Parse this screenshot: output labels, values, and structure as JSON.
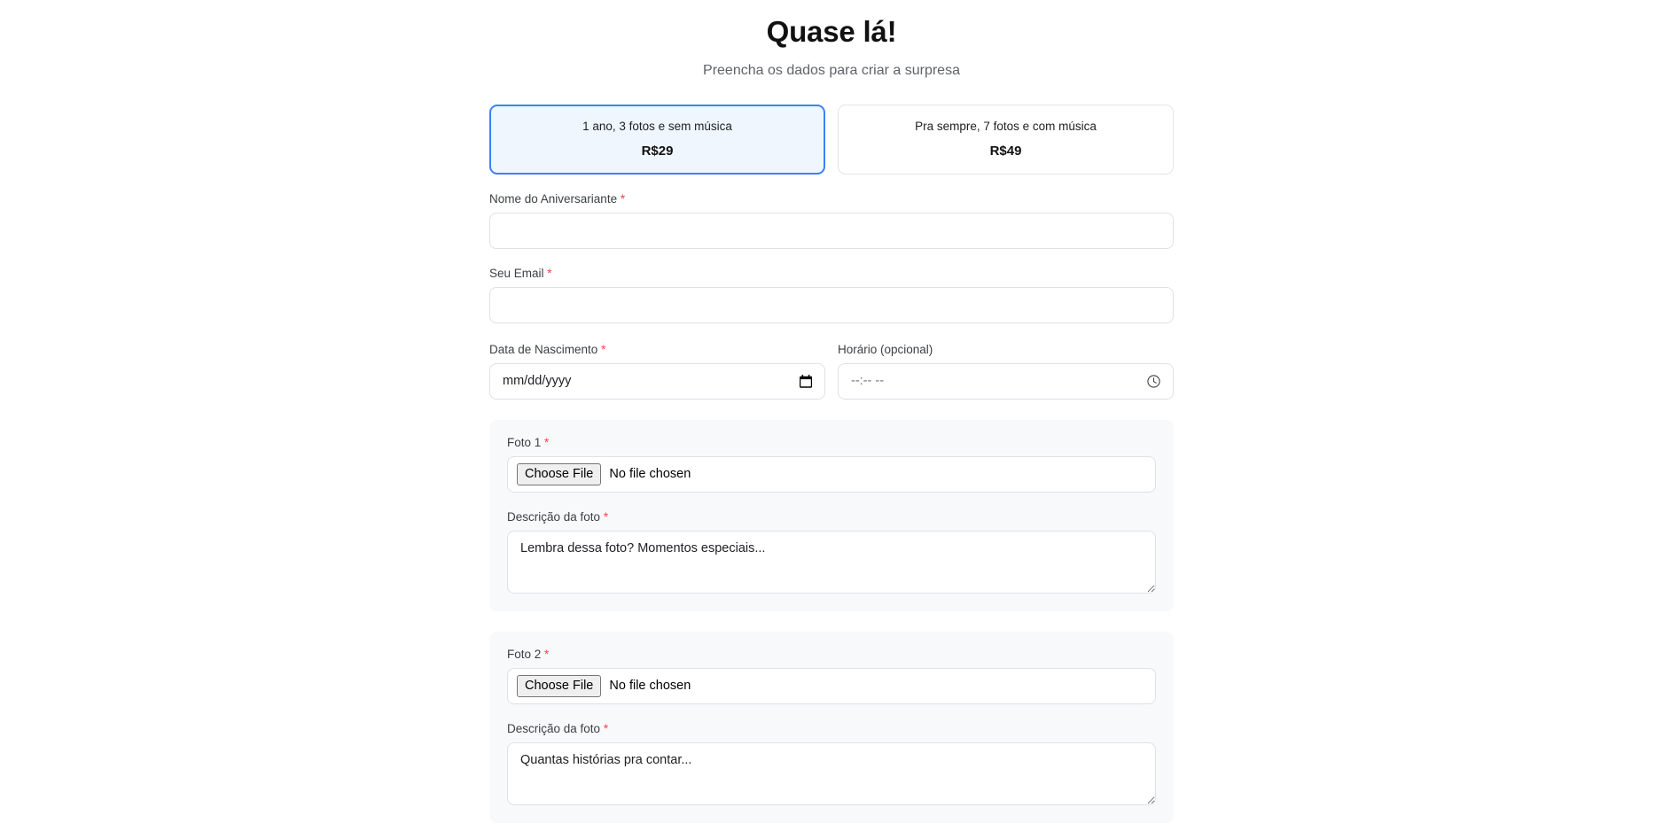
{
  "header": {
    "title": "Quase lá!",
    "subtitle": "Preencha os dados para criar a surpresa"
  },
  "plans": [
    {
      "name": "1 ano, 3 fotos e sem música",
      "price": "R$29",
      "selected": true
    },
    {
      "name": "Pra sempre, 7 fotos e com música",
      "price": "R$49",
      "selected": false
    }
  ],
  "form": {
    "required_marker": "*",
    "name_field": {
      "label": "Nome do Aniversariante",
      "value": "",
      "placeholder": ""
    },
    "email_field": {
      "label": "Seu Email",
      "value": "",
      "placeholder": ""
    },
    "birth_date_field": {
      "label": "Data de Nascimento",
      "placeholder": "mm/dd/yyyy",
      "icon": "calendar-icon"
    },
    "time_field": {
      "label": "Horário (opcional)",
      "placeholder": "--:-- --",
      "icon": "clock-icon"
    }
  },
  "photos": [
    {
      "photo_label": "Foto 1",
      "file_button": "Choose File",
      "file_status": "No file chosen",
      "desc_label": "Descrição da foto",
      "desc_placeholder": "Lembra dessa foto? Momentos especiais..."
    },
    {
      "photo_label": "Foto 2",
      "file_button": "Choose File",
      "file_status": "No file chosen",
      "desc_label": "Descrição da foto",
      "desc_placeholder": "Quantas histórias pra contar..."
    }
  ],
  "colors": {
    "accent": "#3b82f6",
    "selected_bg": "#eff6fd",
    "required": "#ef4444",
    "card_bg": "#f8f9fb",
    "border": "#dfe1e5"
  }
}
